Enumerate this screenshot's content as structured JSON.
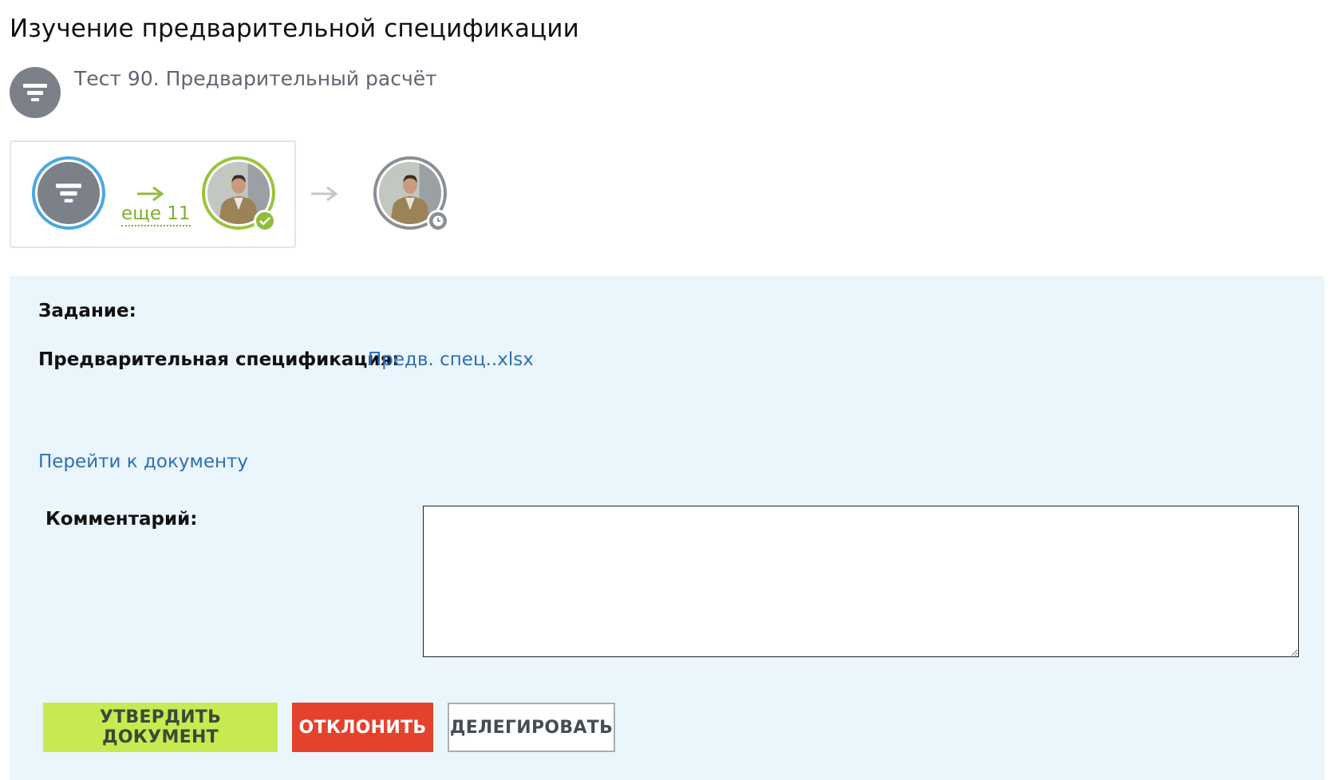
{
  "header": {
    "title": "Изучение предварительной спецификации",
    "task_name": "Тест 90. Предварительный расчёт"
  },
  "route": {
    "more_label": "еще 11",
    "icons": [
      "filter-icon",
      "arrow-right-icon",
      "check-icon",
      "clock-icon"
    ],
    "colors": {
      "start_ring": "#4aa9dd",
      "done_ring": "#9ac43c",
      "pending_ring": "#8a8e95"
    }
  },
  "panel": {
    "task_label": "Задание:",
    "spec_label": "Предварительная спецификация:",
    "spec_link": "Предв. спец..xlsx",
    "goto_link": "Перейти к документу",
    "comment_label": "Комментарий:",
    "comment_value": ""
  },
  "actions": {
    "approve": "Утвердить документ",
    "reject": "Отклонить",
    "delegate": "Делегировать"
  },
  "colors": {
    "panel_bg": "#eaf6fc",
    "link": "#2f6db5",
    "approve_bg": "#c7ea52",
    "reject_bg": "#e3432b"
  }
}
